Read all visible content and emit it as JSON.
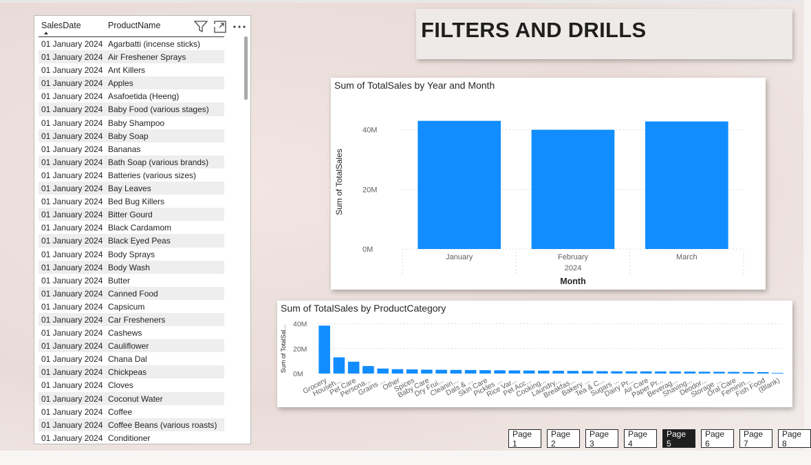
{
  "title": "FILTERS AND DRILLS",
  "table": {
    "columns": [
      "SalesDate",
      "ProductName"
    ],
    "rows": [
      [
        "01 January 2024",
        "Agarbatti (incense sticks)"
      ],
      [
        "01 January 2024",
        "Air Freshener Sprays"
      ],
      [
        "01 January 2024",
        "Ant Killers"
      ],
      [
        "01 January 2024",
        "Apples"
      ],
      [
        "01 January 2024",
        "Asafoetida (Heeng)"
      ],
      [
        "01 January 2024",
        "Baby Food (various stages)"
      ],
      [
        "01 January 2024",
        "Baby Shampoo"
      ],
      [
        "01 January 2024",
        "Baby Soap"
      ],
      [
        "01 January 2024",
        "Bananas"
      ],
      [
        "01 January 2024",
        "Bath Soap (various brands)"
      ],
      [
        "01 January 2024",
        "Batteries (various sizes)"
      ],
      [
        "01 January 2024",
        "Bay Leaves"
      ],
      [
        "01 January 2024",
        "Bed Bug Killers"
      ],
      [
        "01 January 2024",
        "Bitter Gourd"
      ],
      [
        "01 January 2024",
        "Black Cardamom"
      ],
      [
        "01 January 2024",
        "Black Eyed Peas"
      ],
      [
        "01 January 2024",
        "Body Sprays"
      ],
      [
        "01 January 2024",
        "Body Wash"
      ],
      [
        "01 January 2024",
        "Butter"
      ],
      [
        "01 January 2024",
        "Canned Food"
      ],
      [
        "01 January 2024",
        "Capsicum"
      ],
      [
        "01 January 2024",
        "Car Fresheners"
      ],
      [
        "01 January 2024",
        "Cashews"
      ],
      [
        "01 January 2024",
        "Cauliflower"
      ],
      [
        "01 January 2024",
        "Chana Dal"
      ],
      [
        "01 January 2024",
        "Chickpeas"
      ],
      [
        "01 January 2024",
        "Cloves"
      ],
      [
        "01 January 2024",
        "Coconut Water"
      ],
      [
        "01 January 2024",
        "Coffee"
      ],
      [
        "01 January 2024",
        "Coffee Beans (various roasts)"
      ],
      [
        "01 January 2024",
        "Conditioner"
      ]
    ],
    "icons": [
      "filter-icon",
      "focus-mode-icon",
      "more-options-icon"
    ]
  },
  "chart_data": [
    {
      "type": "bar",
      "title": "Sum of TotalSales by Year and Month",
      "xlabel": "Month",
      "x_group_label": "2024",
      "ylabel": "Sum of TotalSales",
      "categories": [
        "January",
        "February",
        "March"
      ],
      "values": [
        43000000,
        40000000,
        42800000
      ],
      "yticks": [
        "0M",
        "20M",
        "40M"
      ],
      "ylim": [
        0,
        45000000
      ],
      "color": "#118dff",
      "grid": true
    },
    {
      "type": "bar",
      "title": "Sum of TotalSales by ProductCategory",
      "ylabel": "Sum of TotalSal...",
      "categories": [
        "Grocery",
        "Househ...",
        "Pet Care",
        "Persona...",
        "Grains ...",
        "Other",
        "Spices",
        "Baby Care",
        "Dry Frui...",
        "Cleanin...",
        "Dals & ...",
        "Skin Care",
        "Pickles ...",
        "Rice Var...",
        "Pet Acc...",
        "Cooking...",
        "Laundry...",
        "Breakfas...",
        "Bakery ...",
        "Tea & C...",
        "Sugars ...",
        "Dairy Pr...",
        "Air Care",
        "Paper Pr...",
        "Beverag...",
        "Shaving...",
        "Deodor...",
        "Storage ...",
        "Oral Care",
        "Feminin...",
        "Fish Food",
        "(Blank)"
      ],
      "values": [
        38500000,
        13000000,
        9500000,
        6000000,
        4000000,
        3500000,
        3300000,
        3100000,
        3000000,
        2900000,
        2800000,
        2700000,
        2600000,
        2500000,
        2400000,
        2300000,
        2200000,
        2100000,
        2000000,
        1900000,
        1800000,
        1750000,
        1700000,
        1650000,
        1600000,
        1550000,
        1450000,
        1400000,
        1300000,
        1200000,
        1100000,
        500000
      ],
      "yticks": [
        "0M",
        "20M",
        "40M"
      ],
      "ylim": [
        0,
        42000000
      ],
      "color": "#118dff",
      "grid": true
    }
  ],
  "pager": {
    "pages": [
      "Page 1",
      "Page 2",
      "Page 3",
      "Page 4",
      "Page 5",
      "Page 6",
      "Page 7",
      "Page 8"
    ],
    "active": "Page 5"
  }
}
